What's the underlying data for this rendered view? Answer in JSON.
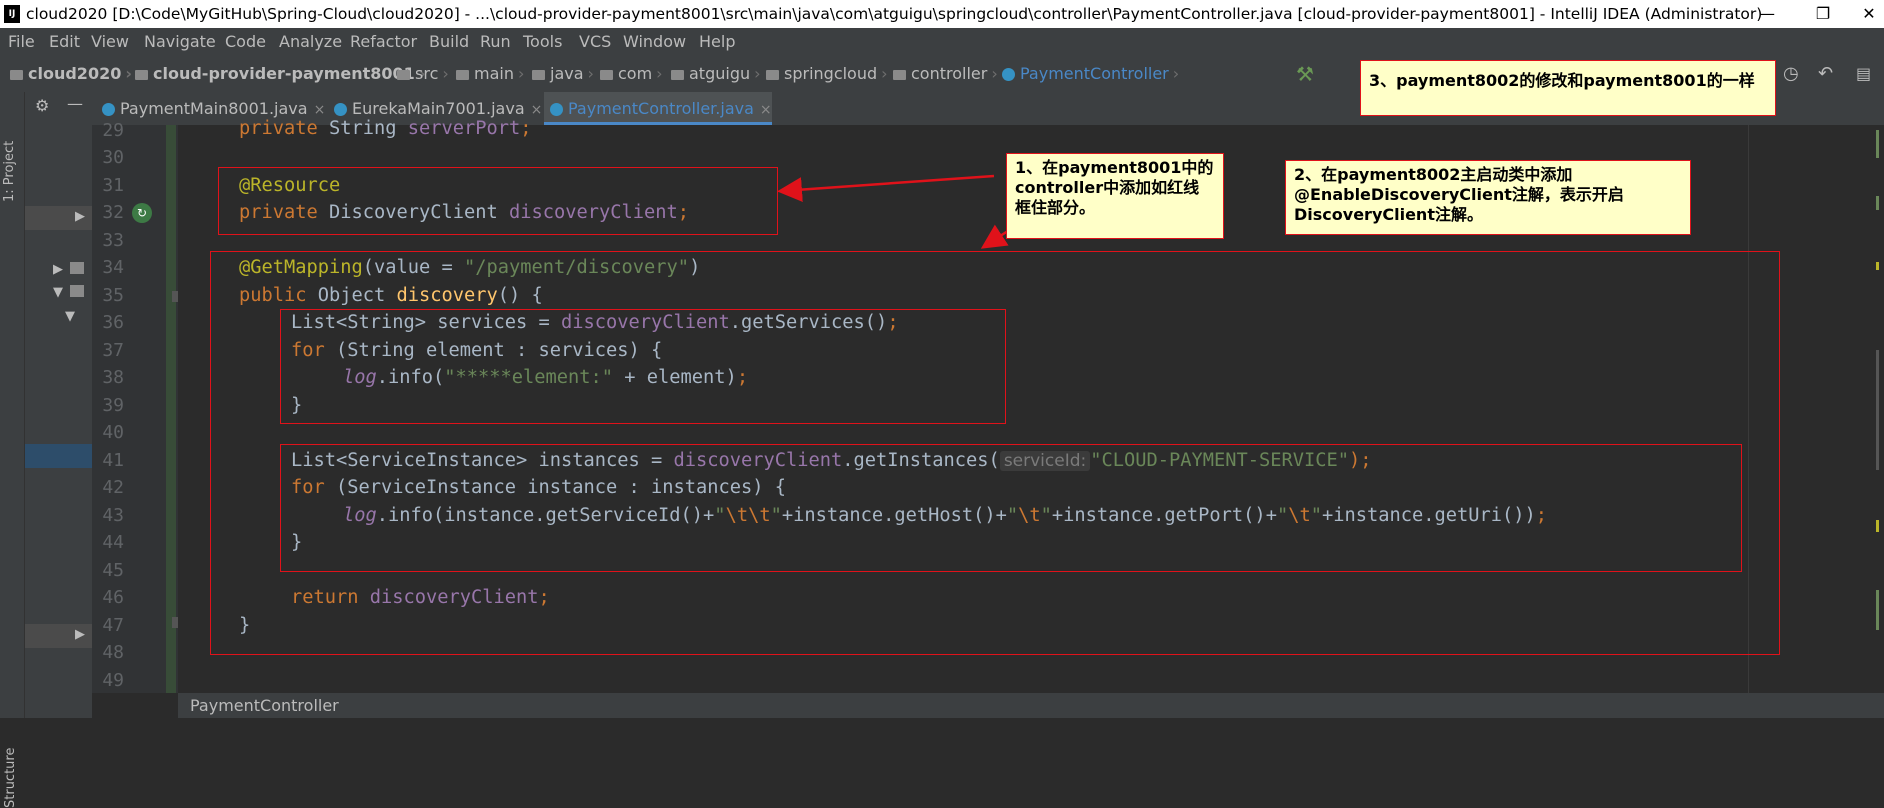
{
  "window": {
    "title": "cloud2020 [D:\\Code\\MyGitHub\\Spring-Cloud\\cloud2020] - ...\\cloud-provider-payment8001\\src\\main\\java\\com\\atguigu\\springcloud\\controller\\PaymentController.java [cloud-provider-payment8001] - IntelliJ IDEA (Administrator)",
    "minimize": "—",
    "maximize": "❐",
    "close": "✕"
  },
  "menu": [
    "File",
    "Edit",
    "View",
    "Navigate",
    "Code",
    "Analyze",
    "Refactor",
    "Build",
    "Run",
    "Tools",
    "VCS",
    "Window",
    "Help"
  ],
  "breadcrumbs": [
    "cloud2020",
    "cloud-provider-payment8001",
    "src",
    "main",
    "java",
    "com",
    "atguigu",
    "springcloud",
    "controller",
    "PaymentController"
  ],
  "tool_window_labels": {
    "project": "1: Project",
    "structure": "Structure"
  },
  "tabs": [
    {
      "label": "PaymentMain8001.java",
      "close": "×"
    },
    {
      "label": "EurekaMain7001.java",
      "close": "×"
    },
    {
      "label": "PaymentController.java",
      "close": "×"
    }
  ],
  "line_numbers": [
    "29",
    "30",
    "31",
    "32",
    "33",
    "34",
    "35",
    "36",
    "37",
    "38",
    "39",
    "40",
    "41",
    "42",
    "43",
    "44",
    "45",
    "46",
    "47",
    "48",
    "49"
  ],
  "code": {
    "l29": {
      "kw": "private ",
      "rest": "String ",
      "field": "serverPort",
      "end": ";"
    },
    "l31": {
      "ann": "@Resource"
    },
    "l32": {
      "kw": "private ",
      "type": "DiscoveryClient ",
      "field": "discoveryClient",
      "end": ";"
    },
    "l34": {
      "ann": "@GetMapping",
      "pre": "(value = ",
      "str": "\"/payment/discovery\"",
      "end": ")"
    },
    "l35": {
      "kw": "public ",
      "type": "Object ",
      "fn": "discovery",
      "end": "() {"
    },
    "l36": {
      "a": "List<String> services = ",
      "field": "discoveryClient",
      "b": ".getServices()",
      "end": ";"
    },
    "l37": {
      "kw": "for ",
      "rest": "(String element : services) {"
    },
    "l38": {
      "log": "log",
      "a": ".info(",
      "str": "\"*****element:\"",
      "b": " + element)",
      "end": ";"
    },
    "l39": {
      "rest": "}"
    },
    "l41": {
      "a": "List<ServiceInstance> instances = ",
      "field": "discoveryClient",
      "b": ".getInstances(",
      "hint": "serviceId:",
      "str": "\"CLOUD-PAYMENT-SERVICE\"",
      "end": ");"
    },
    "l42": {
      "kw": "for ",
      "rest": "(ServiceInstance instance : instances) {"
    },
    "l43": {
      "log": "log",
      "a": ".info(instance.getServiceId()+",
      "q1": "\"",
      "e1": "\\t\\t",
      "q2": "\"",
      "b": "+instance.getHost()+",
      "q3": "\"",
      "e2": "\\t",
      "q4": "\"",
      "c": "+instance.getPort()+",
      "q5": "\"",
      "e3": "\\t",
      "q6": "\"",
      "d": "+instance.getUri())",
      "end": ";"
    },
    "l44": {
      "rest": "}"
    },
    "l46": {
      "kw": "return ",
      "field": "discoveryClient",
      "end": ";"
    },
    "l47": {
      "rest": "}"
    }
  },
  "notes": {
    "n1": "1、在payment8001中的controller中添加如红线框住部分。",
    "n2": "2、在payment8002主启动类中添加@EnableDiscoveryClient注解，表示开启DiscoveryClient注解。",
    "n3": "3、payment8002的修改和payment8001的一样"
  },
  "status": {
    "breadcrumb": "PaymentController"
  },
  "colors": {
    "annotation_border": "#e0121a",
    "note_bg": "#ffffc8",
    "active_tab_underline": "#4a88c7"
  }
}
